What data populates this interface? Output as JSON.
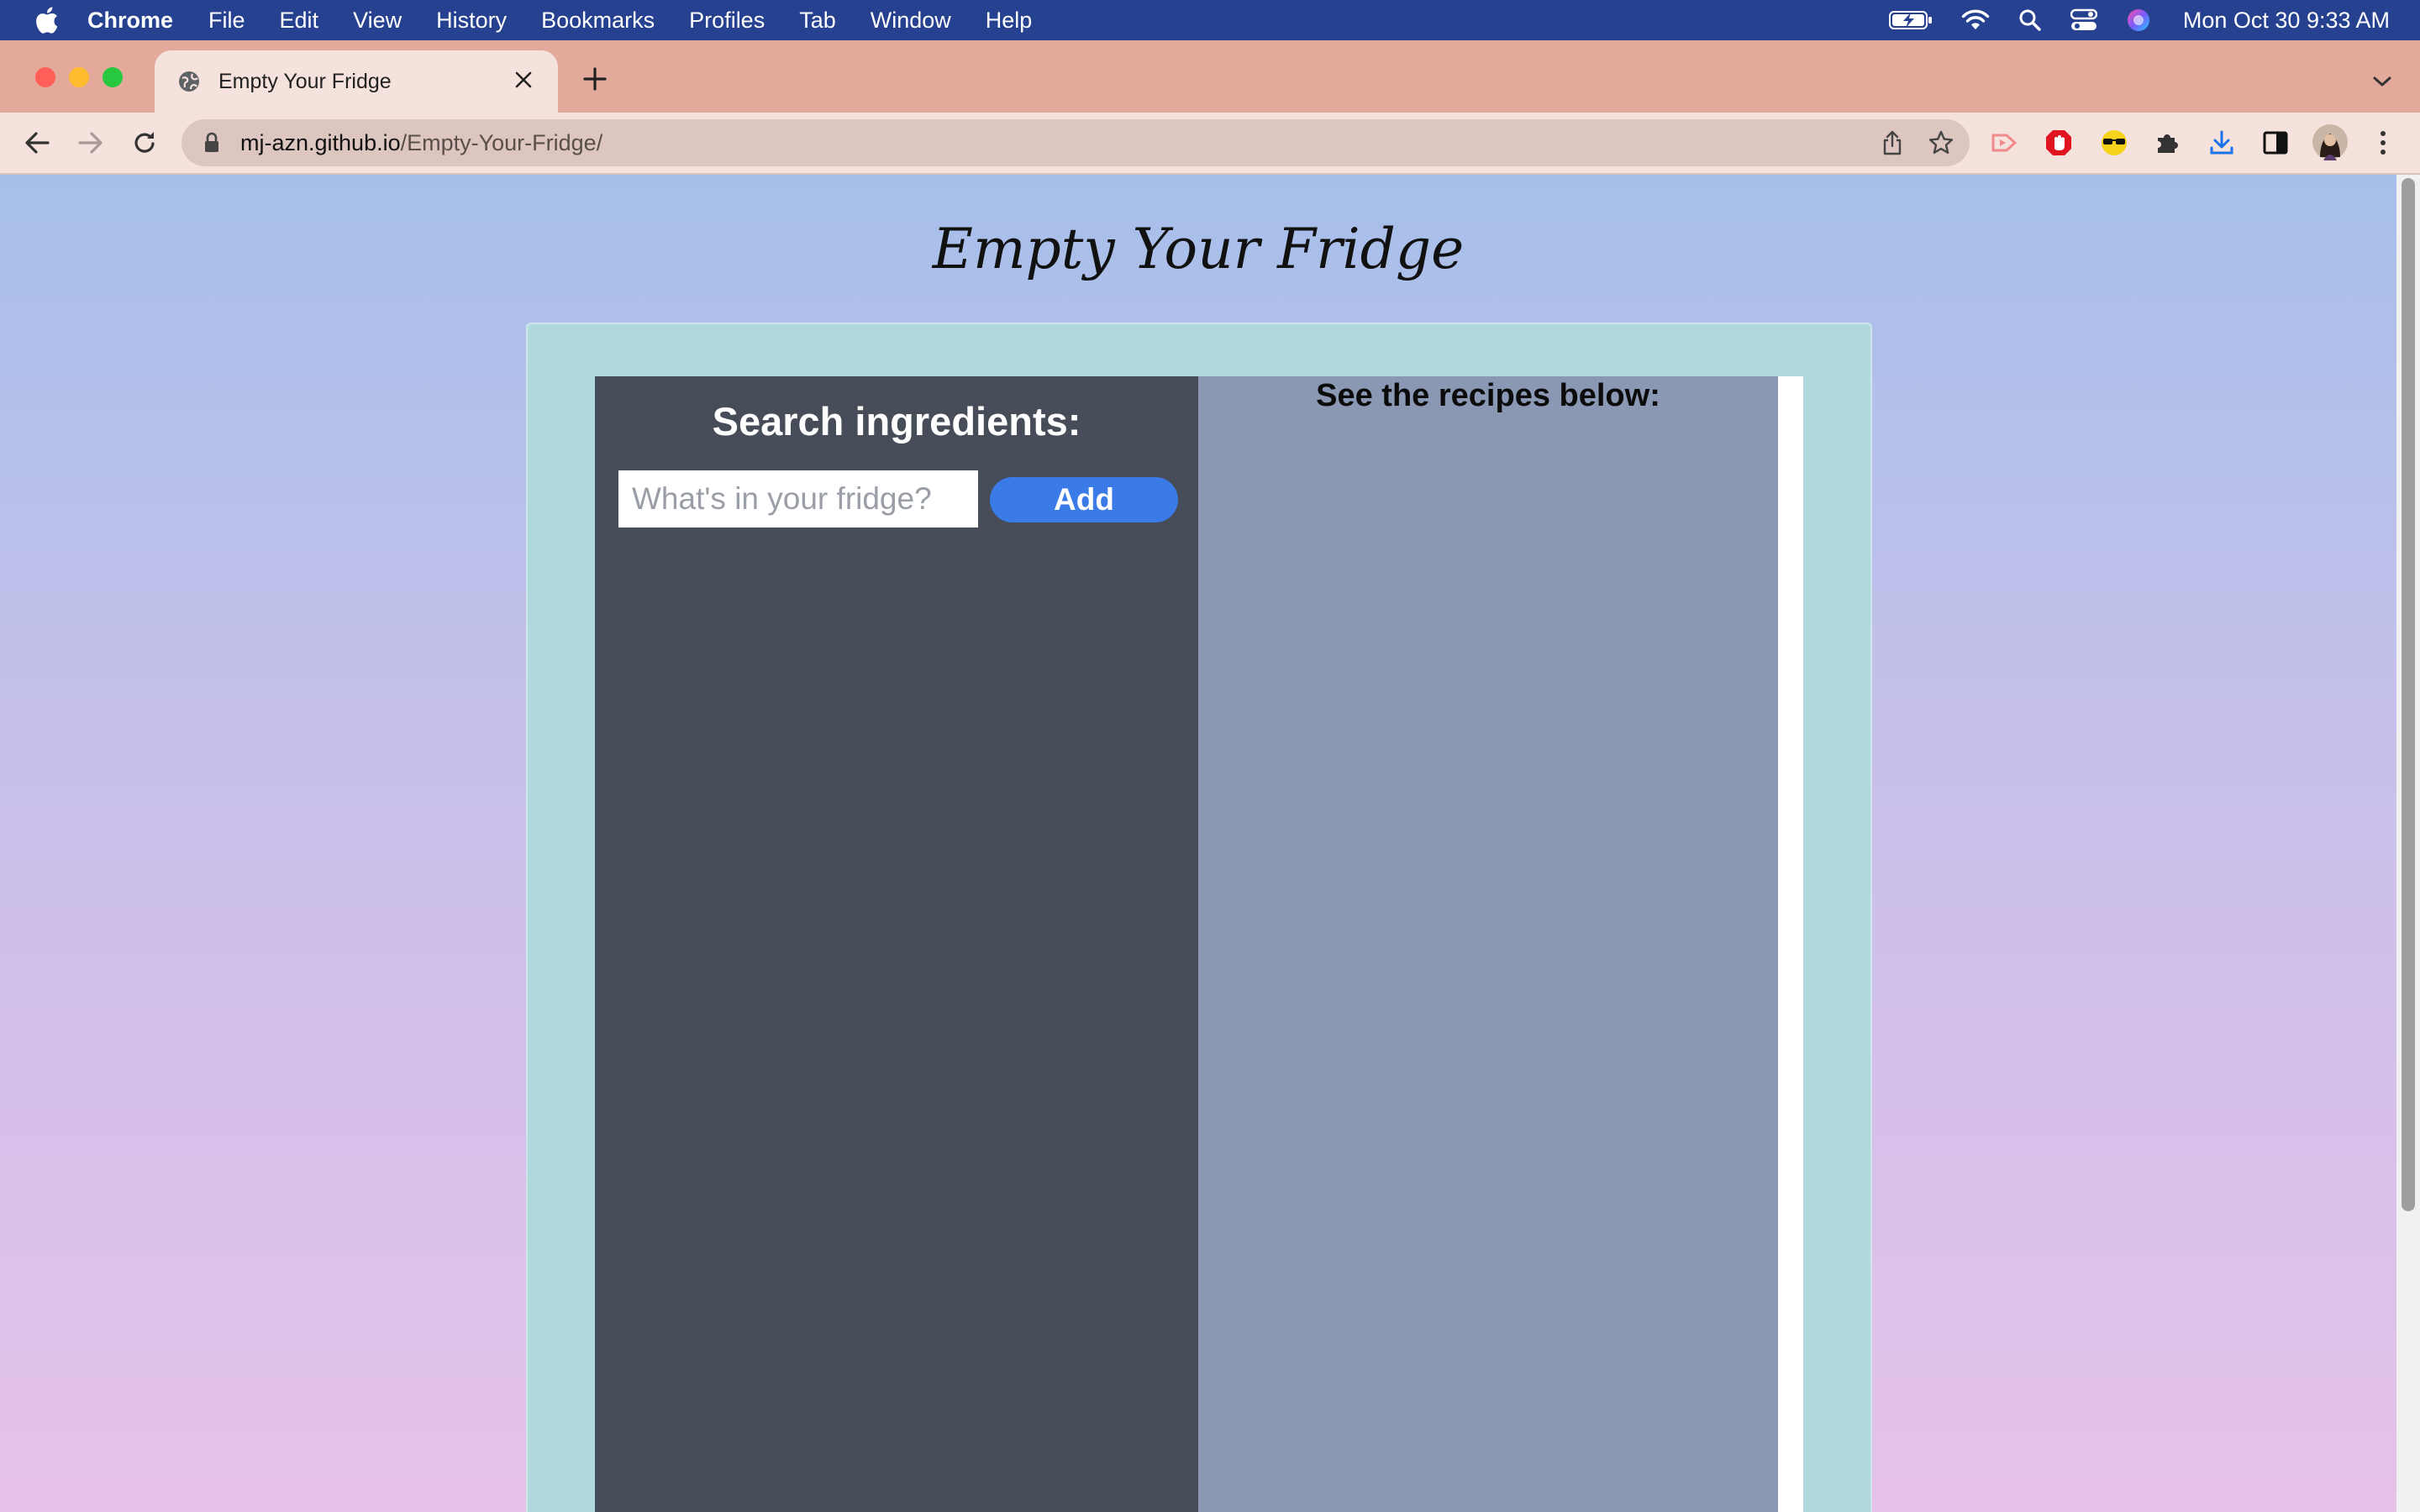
{
  "menubar": {
    "app_name": "Chrome",
    "items": [
      "File",
      "Edit",
      "View",
      "History",
      "Bookmarks",
      "Profiles",
      "Tab",
      "Window",
      "Help"
    ],
    "clock": "Mon Oct 30  9:33 AM",
    "status_icons": [
      "battery-charging-icon",
      "wifi-icon",
      "spotlight-search-icon",
      "control-center-icon",
      "siri-icon"
    ]
  },
  "browser": {
    "tab_title": "Empty Your Fridge",
    "url_host": "mj-azn.github.io",
    "url_path": "/Empty-Your-Fridge/",
    "extensions": [
      "cast-extension-icon",
      "adblock-extension-icon",
      "sunglasses-extension-icon",
      "extensions-puzzle-icon",
      "downloads-icon",
      "side-panel-icon"
    ]
  },
  "page": {
    "title": "Empty Your Fridge",
    "search_heading": "Search ingredients:",
    "input_placeholder": "What's in your fridge?",
    "add_button_label": "Add",
    "recipes_heading": "See the recipes below:"
  },
  "colors": {
    "background_top": "#a6bfe9",
    "background_bottom": "#e6c1e8",
    "container": "#b0d9de",
    "left_panel": "#464c58",
    "right_panel": "#8a98b4",
    "add_button": "#3b7be8",
    "menubar": "#26418f",
    "tab_strip": "#e3a99b"
  }
}
